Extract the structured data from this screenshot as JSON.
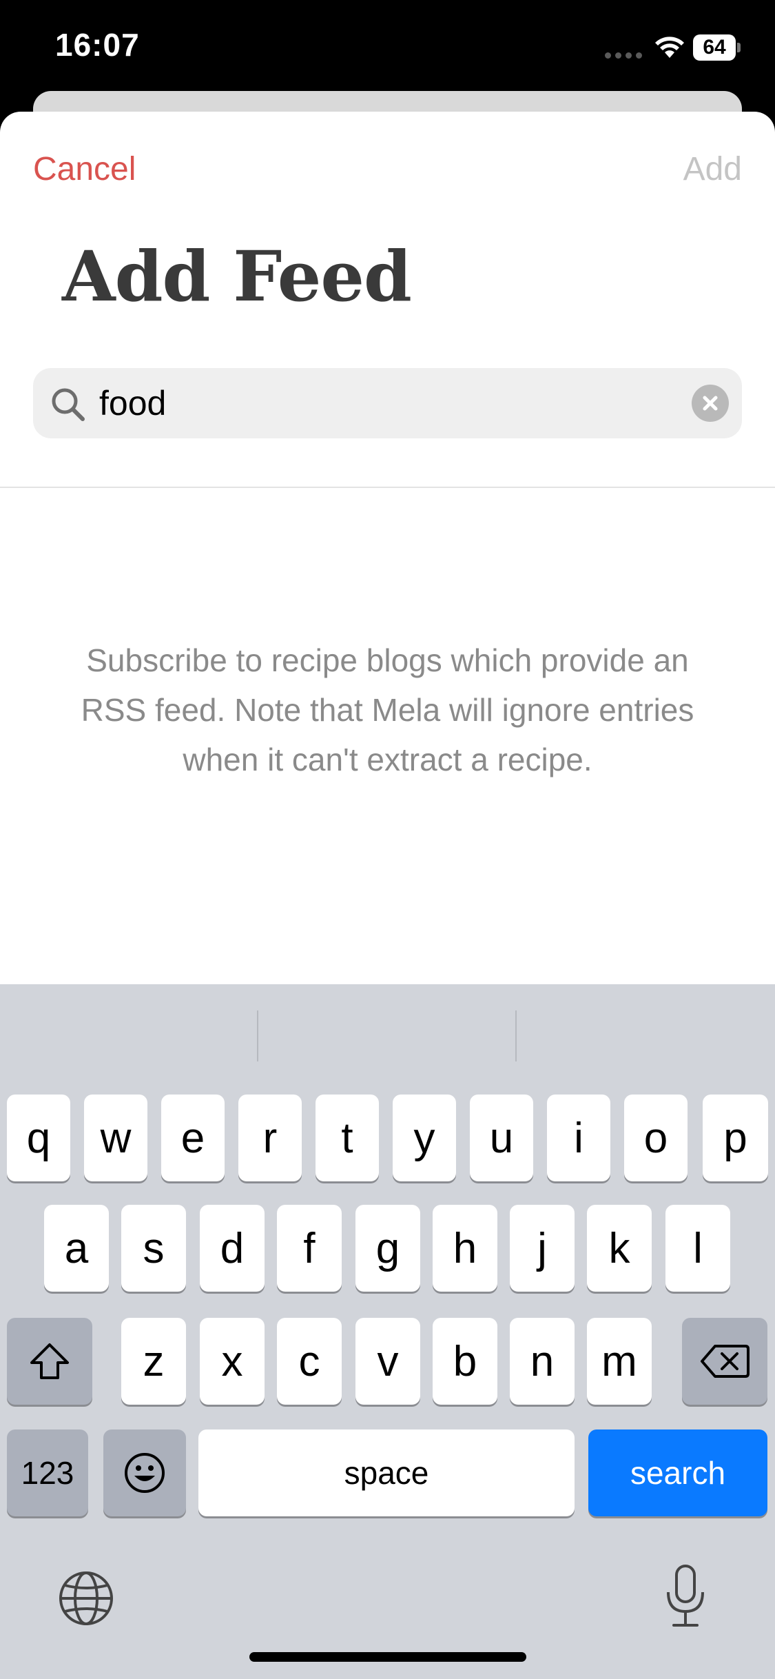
{
  "status_bar": {
    "time": "16:07",
    "battery": "64"
  },
  "nav": {
    "cancel_label": "Cancel",
    "add_label": "Add"
  },
  "page": {
    "title": "Add Feed"
  },
  "search": {
    "value": "food"
  },
  "info": {
    "text": "Subscribe to recipe blogs which provide an RSS feed. Note that Mela will ignore entries when it can't extract a recipe."
  },
  "keyboard": {
    "row1": [
      "q",
      "w",
      "e",
      "r",
      "t",
      "y",
      "u",
      "i",
      "o",
      "p"
    ],
    "row2": [
      "a",
      "s",
      "d",
      "f",
      "g",
      "h",
      "j",
      "k",
      "l"
    ],
    "row3": [
      "z",
      "x",
      "c",
      "v",
      "b",
      "n",
      "m"
    ],
    "numbers_label": "123",
    "space_label": "space",
    "search_label": "search"
  },
  "colors": {
    "accent_red": "#d9534f",
    "disabled_gray": "#c4c4c4",
    "key_blue": "#0a7aff",
    "keyboard_bg": "#d1d4da"
  }
}
